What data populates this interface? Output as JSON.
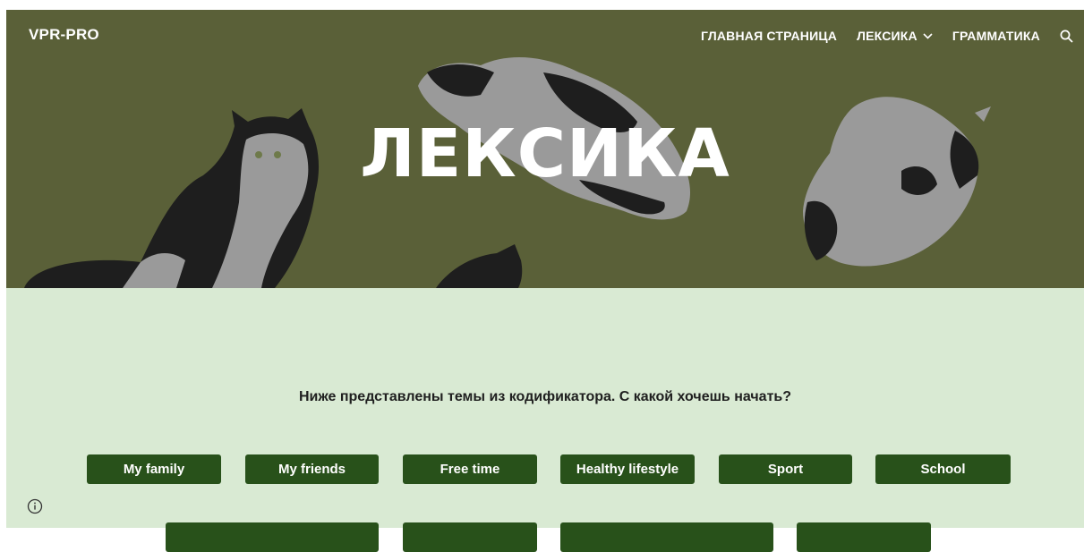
{
  "header": {
    "brand": "VPR-PRO",
    "nav": [
      {
        "label": "ГЛАВНАЯ СТРАНИЦА"
      },
      {
        "label": "ЛЕКСИКА"
      },
      {
        "label": "ГРАММАТИКА"
      }
    ],
    "dropdown_icon": "chevron-down-icon",
    "search_icon": "search-icon"
  },
  "hero": {
    "title": "ЛЕКСИКА"
  },
  "main": {
    "intro": "Ниже представлены темы из кодификатора. С какой хочешь начать?",
    "topics_row1": [
      "My family",
      "My friends",
      "Free time",
      "Healthy lifestyle",
      "Sport",
      "School"
    ],
    "topics_row2": [
      "",
      "",
      "",
      ""
    ]
  },
  "footer": {
    "info_icon": "info-icon"
  },
  "colors": {
    "hero_bg": "#5a6038",
    "content_bg": "#d9ead3",
    "button_bg": "#28511a",
    "text_white": "#ffffff"
  }
}
